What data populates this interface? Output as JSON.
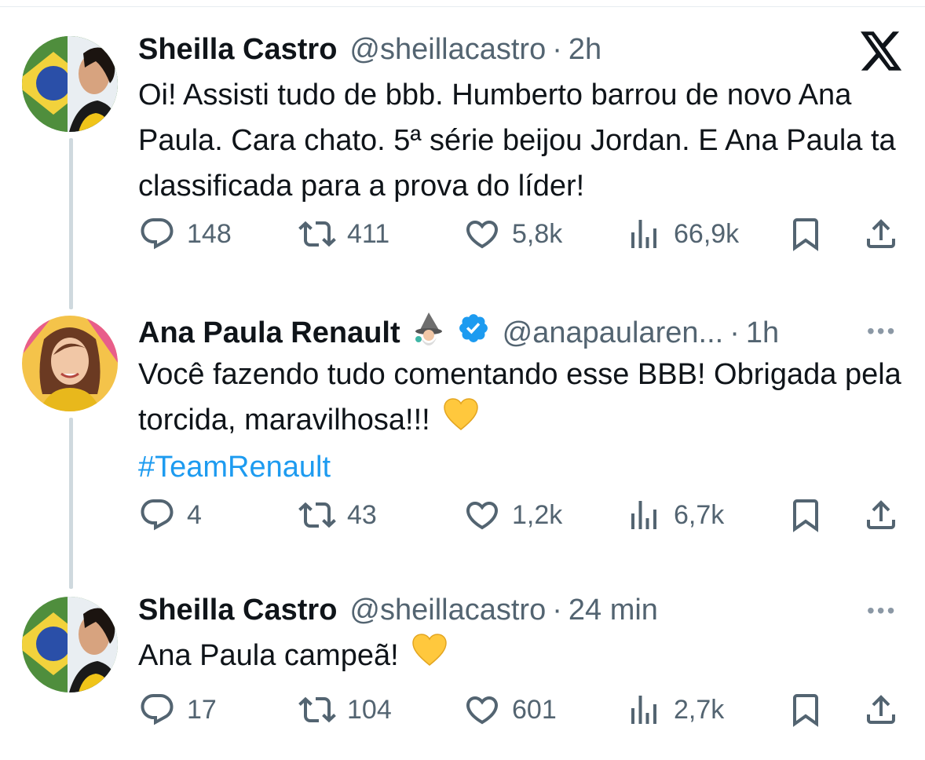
{
  "tweets": [
    {
      "name": "Sheilla Castro",
      "handle": "@sheillacastro",
      "separator": "·",
      "time": "2h",
      "text": "Oi! Assisti tudo de bbb. Humberto barrou de novo Ana Paula. Cara chato. 5ª série beijou Jordan. E Ana Paula ta classificada para a prova do líder!",
      "replies": "148",
      "retweets": "411",
      "likes": "5,8k",
      "views": "66,9k"
    },
    {
      "name": "Ana Paula Renault",
      "handle": "@anapaularen...",
      "separator": "·",
      "time": "1h",
      "text": "Você fazendo tudo comentando esse BBB! Obrigada pela torcida, maravilhosa!!!",
      "hashtag": "#TeamRenault",
      "replies": "4",
      "retweets": "43",
      "likes": "1,2k",
      "views": "6,7k"
    },
    {
      "name": "Sheilla Castro",
      "handle": "@sheillacastro",
      "separator": "·",
      "time": "24 min",
      "text": "Ana Paula campeã!",
      "replies": "17",
      "retweets": "104",
      "likes": "601",
      "views": "2,7k"
    }
  ],
  "colors": {
    "text": "#0f1419",
    "secondary": "#536471",
    "link": "#1d9bf0",
    "verified": "#1d9bf0",
    "thread_line": "#cfd9de",
    "heart_emoji": "#ffc83d"
  },
  "icons": [
    "x-logo-icon",
    "more-icon",
    "reply-icon",
    "retweet-icon",
    "like-icon",
    "views-icon",
    "bookmark-icon",
    "share-icon",
    "verified-icon",
    "mage-emoji-icon",
    "yellow-heart-emoji"
  ]
}
